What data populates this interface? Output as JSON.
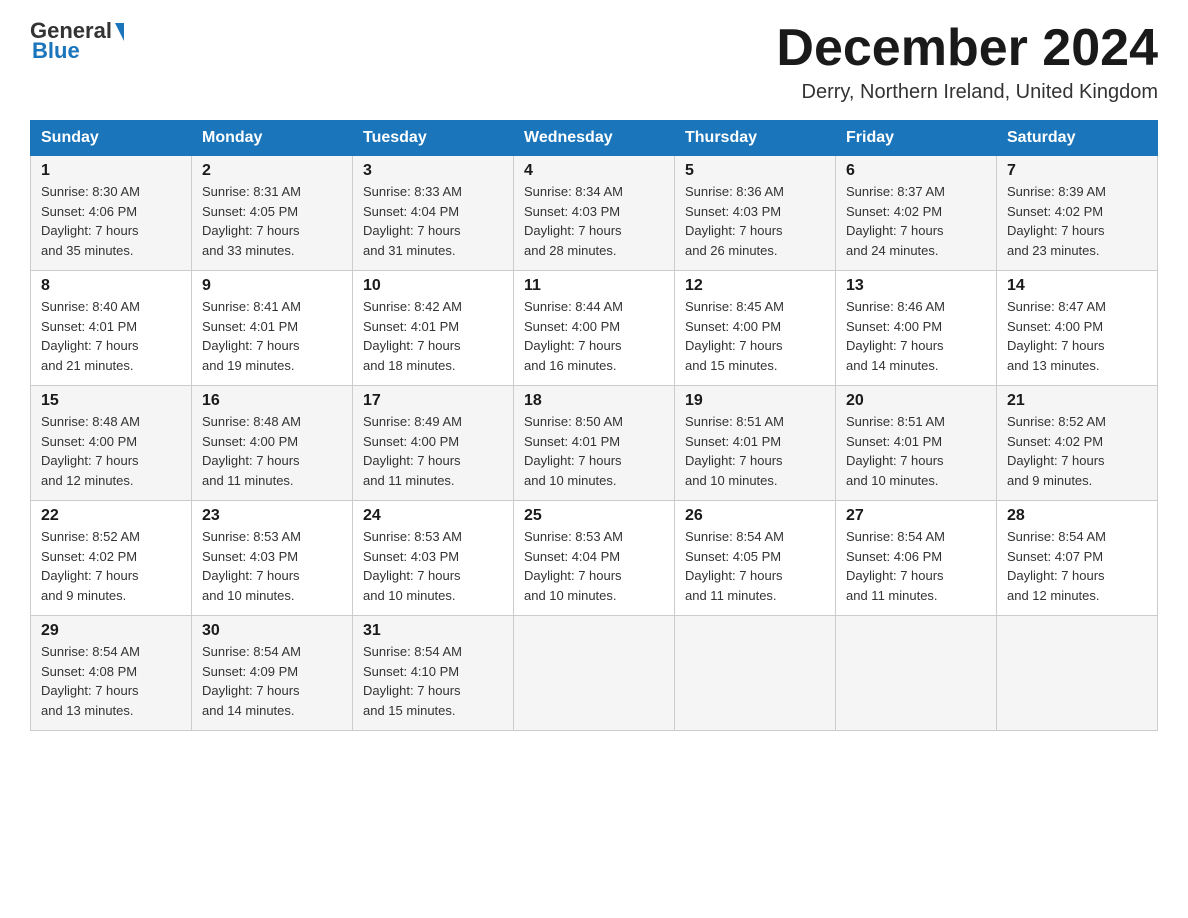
{
  "header": {
    "logo": {
      "top": "General",
      "arrow": "▶",
      "bottom": "Blue"
    },
    "title": "December 2024",
    "location": "Derry, Northern Ireland, United Kingdom"
  },
  "days_of_week": [
    "Sunday",
    "Monday",
    "Tuesday",
    "Wednesday",
    "Thursday",
    "Friday",
    "Saturday"
  ],
  "weeks": [
    [
      {
        "day": "1",
        "sunrise": "8:30 AM",
        "sunset": "4:06 PM",
        "daylight": "7 hours and 35 minutes."
      },
      {
        "day": "2",
        "sunrise": "8:31 AM",
        "sunset": "4:05 PM",
        "daylight": "7 hours and 33 minutes."
      },
      {
        "day": "3",
        "sunrise": "8:33 AM",
        "sunset": "4:04 PM",
        "daylight": "7 hours and 31 minutes."
      },
      {
        "day": "4",
        "sunrise": "8:34 AM",
        "sunset": "4:03 PM",
        "daylight": "7 hours and 28 minutes."
      },
      {
        "day": "5",
        "sunrise": "8:36 AM",
        "sunset": "4:03 PM",
        "daylight": "7 hours and 26 minutes."
      },
      {
        "day": "6",
        "sunrise": "8:37 AM",
        "sunset": "4:02 PM",
        "daylight": "7 hours and 24 minutes."
      },
      {
        "day": "7",
        "sunrise": "8:39 AM",
        "sunset": "4:02 PM",
        "daylight": "7 hours and 23 minutes."
      }
    ],
    [
      {
        "day": "8",
        "sunrise": "8:40 AM",
        "sunset": "4:01 PM",
        "daylight": "7 hours and 21 minutes."
      },
      {
        "day": "9",
        "sunrise": "8:41 AM",
        "sunset": "4:01 PM",
        "daylight": "7 hours and 19 minutes."
      },
      {
        "day": "10",
        "sunrise": "8:42 AM",
        "sunset": "4:01 PM",
        "daylight": "7 hours and 18 minutes."
      },
      {
        "day": "11",
        "sunrise": "8:44 AM",
        "sunset": "4:00 PM",
        "daylight": "7 hours and 16 minutes."
      },
      {
        "day": "12",
        "sunrise": "8:45 AM",
        "sunset": "4:00 PM",
        "daylight": "7 hours and 15 minutes."
      },
      {
        "day": "13",
        "sunrise": "8:46 AM",
        "sunset": "4:00 PM",
        "daylight": "7 hours and 14 minutes."
      },
      {
        "day": "14",
        "sunrise": "8:47 AM",
        "sunset": "4:00 PM",
        "daylight": "7 hours and 13 minutes."
      }
    ],
    [
      {
        "day": "15",
        "sunrise": "8:48 AM",
        "sunset": "4:00 PM",
        "daylight": "7 hours and 12 minutes."
      },
      {
        "day": "16",
        "sunrise": "8:48 AM",
        "sunset": "4:00 PM",
        "daylight": "7 hours and 11 minutes."
      },
      {
        "day": "17",
        "sunrise": "8:49 AM",
        "sunset": "4:00 PM",
        "daylight": "7 hours and 11 minutes."
      },
      {
        "day": "18",
        "sunrise": "8:50 AM",
        "sunset": "4:01 PM",
        "daylight": "7 hours and 10 minutes."
      },
      {
        "day": "19",
        "sunrise": "8:51 AM",
        "sunset": "4:01 PM",
        "daylight": "7 hours and 10 minutes."
      },
      {
        "day": "20",
        "sunrise": "8:51 AM",
        "sunset": "4:01 PM",
        "daylight": "7 hours and 10 minutes."
      },
      {
        "day": "21",
        "sunrise": "8:52 AM",
        "sunset": "4:02 PM",
        "daylight": "7 hours and 9 minutes."
      }
    ],
    [
      {
        "day": "22",
        "sunrise": "8:52 AM",
        "sunset": "4:02 PM",
        "daylight": "7 hours and 9 minutes."
      },
      {
        "day": "23",
        "sunrise": "8:53 AM",
        "sunset": "4:03 PM",
        "daylight": "7 hours and 10 minutes."
      },
      {
        "day": "24",
        "sunrise": "8:53 AM",
        "sunset": "4:03 PM",
        "daylight": "7 hours and 10 minutes."
      },
      {
        "day": "25",
        "sunrise": "8:53 AM",
        "sunset": "4:04 PM",
        "daylight": "7 hours and 10 minutes."
      },
      {
        "day": "26",
        "sunrise": "8:54 AM",
        "sunset": "4:05 PM",
        "daylight": "7 hours and 11 minutes."
      },
      {
        "day": "27",
        "sunrise": "8:54 AM",
        "sunset": "4:06 PM",
        "daylight": "7 hours and 11 minutes."
      },
      {
        "day": "28",
        "sunrise": "8:54 AM",
        "sunset": "4:07 PM",
        "daylight": "7 hours and 12 minutes."
      }
    ],
    [
      {
        "day": "29",
        "sunrise": "8:54 AM",
        "sunset": "4:08 PM",
        "daylight": "7 hours and 13 minutes."
      },
      {
        "day": "30",
        "sunrise": "8:54 AM",
        "sunset": "4:09 PM",
        "daylight": "7 hours and 14 minutes."
      },
      {
        "day": "31",
        "sunrise": "8:54 AM",
        "sunset": "4:10 PM",
        "daylight": "7 hours and 15 minutes."
      },
      null,
      null,
      null,
      null
    ]
  ],
  "labels": {
    "sunrise_prefix": "Sunrise: ",
    "sunset_prefix": "Sunset: ",
    "daylight_prefix": "Daylight: "
  }
}
